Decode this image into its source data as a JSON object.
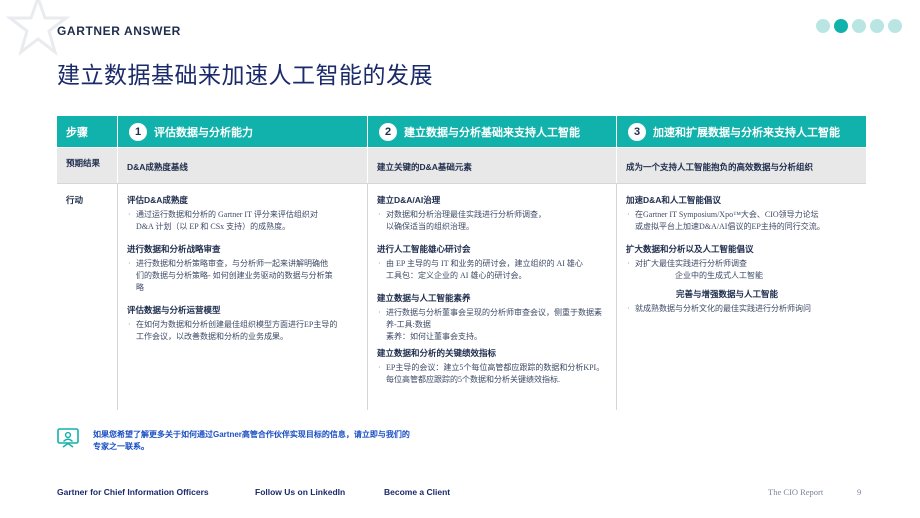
{
  "brand": {
    "name": "GARTNER ANSWER"
  },
  "progress": {
    "total": 5,
    "active_index": 1
  },
  "page": {
    "title": "建立数据基础来加速人工智能的发展"
  },
  "table": {
    "header": {
      "label": "步骤",
      "steps": [
        {
          "num": "1",
          "title": "评估数据与分析能力"
        },
        {
          "num": "2",
          "title": "建立数据与分析基础来支持人工智能"
        },
        {
          "num": "3",
          "title": "加速和扩展数据与分析来支持人工智能"
        }
      ]
    },
    "result": {
      "label": "预期结果",
      "values": [
        "D&A成熟度基线",
        "建立关键的D&A基础元素",
        "成为一个支持人工智能抱负的高效数据与分析组织"
      ]
    },
    "action": {
      "label": "行动",
      "columns": [
        {
          "sections": [
            {
              "title": "评估D&A成熟度",
              "lines": [
                "通过运行数据和分析的 Gartner IT 评分来评估组织对",
                "D&A 计划（以 EP 和 CSx 支持）的成熟度。"
              ]
            },
            {
              "title": "进行数据和分析战略审查",
              "lines": [
                "进行数据和分析策略审查，与分析师一起来讲解明确他",
                "们的数据与分析策略- 如何创建业务驱动的数据与分析策",
                "略"
              ]
            },
            {
              "title": "评估数据与分析运营模型",
              "lines": [
                "在如何为数据和分析创建最佳组织模型方面进行EP主导的",
                "工作会议，以改善数据和分析的业务成果。"
              ]
            }
          ]
        },
        {
          "sections": [
            {
              "title": "建立D&A/AI治理",
              "lines": [
                "对数据和分析治理最佳实践进行分析师调查，",
                "以确保适当的组织治理。"
              ]
            },
            {
              "title": "进行人工智能雄心研讨会",
              "lines": [
                "由 EP 主导的与 IT 和业务的研讨会，建立组织的 AI 雄心",
                "工具包：定义企业的 AI 雄心的研讨会。"
              ]
            },
            {
              "title": "建立数据与人工智能素养",
              "lines": [
                "进行数据与分析董事会呈现的分析师审查会议，侧重于数据素",
                "养-工具:数据",
                "素养：如何让董事会支持。"
              ]
            },
            {
              "title": "建立数据和分析的关键绩效指标",
              "lines": [
                "EP主导的会议：建立5个每位高管都应跟踪的数据和分析KPI。",
                "每位高管都应跟踪的5个数据和分析关键绩效指标."
              ]
            }
          ]
        },
        {
          "sections": [
            {
              "title": "加速D&A和人工智能倡议",
              "lines": [
                "在Gartner IT Symposium/Xpo™大会、CIO领导力论坛",
                "或虚拟平台上加速D&A/AI倡议的EP主持的同行交流。"
              ]
            },
            {
              "title": "扩大数据和分析以及人工智能倡议",
              "lines": [
                "对扩大最佳实践进行分析师调查",
                "企业中的生成式人工智能"
              ]
            },
            {
              "title": "完善与增强数据与人工智能",
              "lines": [
                "就成熟数据与分析文化的最佳实践进行分析师询问"
              ]
            }
          ]
        }
      ]
    }
  },
  "cta": {
    "lines": [
      "如果您希望了解更多关于如何通过Gartner高管合作伙伴实现目标的信息，请立即与我们的",
      "专家之一联系。"
    ]
  },
  "footer": {
    "links": [
      "Gartner for Chief Information Officers",
      "Follow Us on LinkedIn",
      "Become a Client"
    ],
    "report": "The CIO Report",
    "page_number": "9"
  },
  "colors": {
    "teal": "#10b2ab",
    "navy": "#1a2a6a",
    "link_blue": "#1a4fc4",
    "row_gray": "#e8e8e8"
  },
  "icons": {
    "watermark": "star-outline-icon",
    "cta": "presenter-screen-icon"
  }
}
